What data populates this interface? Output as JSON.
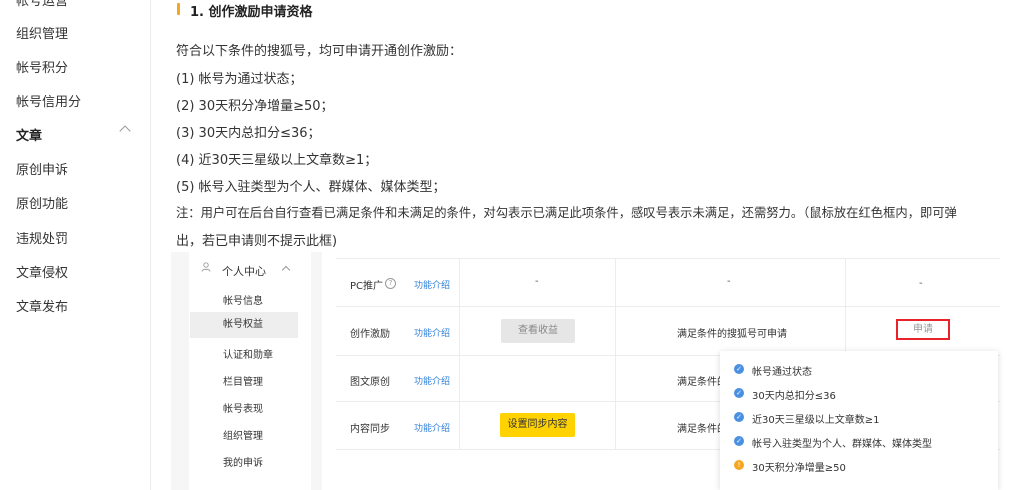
{
  "sidebar": {
    "top_cut": "帐号运营",
    "items": [
      {
        "label": "组织管理"
      },
      {
        "label": "帐号积分"
      },
      {
        "label": "帐号信用分"
      },
      {
        "label": "文章"
      },
      {
        "label": "原创申诉"
      },
      {
        "label": "原创功能"
      },
      {
        "label": "违规处罚"
      },
      {
        "label": "文章侵权"
      },
      {
        "label": "文章发布"
      }
    ]
  },
  "content": {
    "section_title": "1. 创作激励申请资格",
    "intro": "符合以下条件的搜狐号，均可申请开通创作激励：",
    "conditions": [
      "(1) 帐号为通过状态；",
      "(2) 30天积分净增量≥50；",
      "(3) 30天内总扣分≤36；",
      "(4) 近30天三星级以上文章数≥1；",
      "(5) 帐号入驻类型为个人、群媒体、媒体类型；"
    ],
    "note_line1": "注：用户可在后台自行查看已满足条件和未满足的条件，对勾表示已满足此项条件，感叹号表示未满足，还需努力。（鼠标放在红色框内，即可弹",
    "note_line2": "出，若已申请则不提示此框)"
  },
  "screenshot": {
    "menu": {
      "header": "个人中心",
      "items": [
        "帐号信息",
        "帐号权益",
        "认证和勋章",
        "栏目管理",
        "帐号表现",
        "组织管理",
        "我的申诉"
      ]
    },
    "rows": [
      {
        "name": "PC推广",
        "link": "功能介绍",
        "col2": "-",
        "col3": "-",
        "col4": "-"
      },
      {
        "name": "创作激励",
        "link": "功能介绍",
        "button": "查看收益",
        "col3": "满足条件的搜狐号可申请",
        "apply": "申请"
      },
      {
        "name": "图文原创",
        "link": "功能介绍",
        "col3": "满足条件的"
      },
      {
        "name": "内容同步",
        "link": "功能介绍",
        "button": "设置同步内容",
        "col3": "满足条件的"
      }
    ],
    "popup": [
      {
        "text": "帐号通过状态",
        "status": "ok"
      },
      {
        "text": "30天内总扣分≤36",
        "status": "ok"
      },
      {
        "text": "近30天三星级以上文章数≥1",
        "status": "ok"
      },
      {
        "text": "帐号入驻类型为个人、群媒体、媒体类型",
        "status": "ok"
      },
      {
        "text": "30天积分净增量≥50",
        "status": "warn"
      }
    ],
    "colors": {
      "accent": "#f5a623",
      "link": "#2f7fd8",
      "apply_border": "#e8242a",
      "btn_yellow": "#ffd200"
    }
  }
}
